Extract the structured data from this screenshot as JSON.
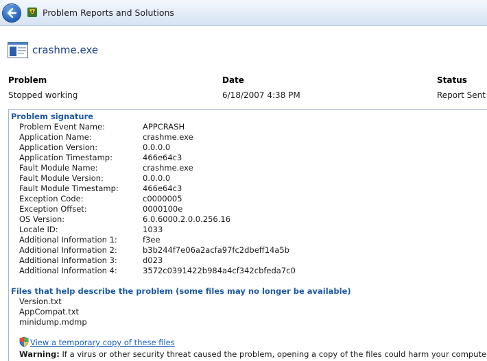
{
  "window": {
    "title": "Problem Reports and Solutions",
    "back_icon": "back-arrow-icon",
    "app_icon": "problem-reports-icon"
  },
  "app": {
    "name": "crashme.exe",
    "icon": "application-window-icon"
  },
  "summary": {
    "headers": {
      "problem": "Problem",
      "date": "Date",
      "status": "Status"
    },
    "values": {
      "problem": "Stopped working",
      "date": "6/18/2007 4:38 PM",
      "status": "Report Sent"
    }
  },
  "signature": {
    "title": "Problem signature",
    "rows": [
      {
        "key": "Problem Event Name:",
        "value": "APPCRASH"
      },
      {
        "key": "Application Name:",
        "value": "crashme.exe"
      },
      {
        "key": "Application Version:",
        "value": "0.0.0.0"
      },
      {
        "key": "Application Timestamp:",
        "value": "466e64c3"
      },
      {
        "key": "Fault Module Name:",
        "value": "crashme.exe"
      },
      {
        "key": "Fault Module Version:",
        "value": "0.0.0.0"
      },
      {
        "key": "Fault Module Timestamp:",
        "value": "466e64c3"
      },
      {
        "key": "Exception Code:",
        "value": "c0000005"
      },
      {
        "key": "Exception Offset:",
        "value": "0000100e"
      },
      {
        "key": "OS Version:",
        "value": "6.0.6000.2.0.0.256.16"
      },
      {
        "key": "Locale ID:",
        "value": "1033"
      },
      {
        "key": "Additional Information 1:",
        "value": "f3ee"
      },
      {
        "key": "Additional Information 2:",
        "value": "b3b244f7e06a2acfa97fc2dbeff14a5b"
      },
      {
        "key": "Additional Information 3:",
        "value": "d023"
      },
      {
        "key": "Additional Information 4:",
        "value": "3572c0391422b984a4cf342cbfeda7c0"
      }
    ]
  },
  "files": {
    "title": "Files that help describe the problem (some files may no longer be available)",
    "items": [
      "Version.txt",
      "AppCompat.txt",
      "minidump.mdmp"
    ]
  },
  "link": {
    "icon": "security-shield-icon",
    "text": "View a temporary copy of these files"
  },
  "warning": {
    "label": "Warning:",
    "text": " If a virus or other security threat caused the problem, opening a copy of the files could harm your computer."
  },
  "colors": {
    "heading_blue": "#1c5aa6",
    "link_blue": "#1560bd",
    "app_name_blue": "#1e3f8a"
  }
}
